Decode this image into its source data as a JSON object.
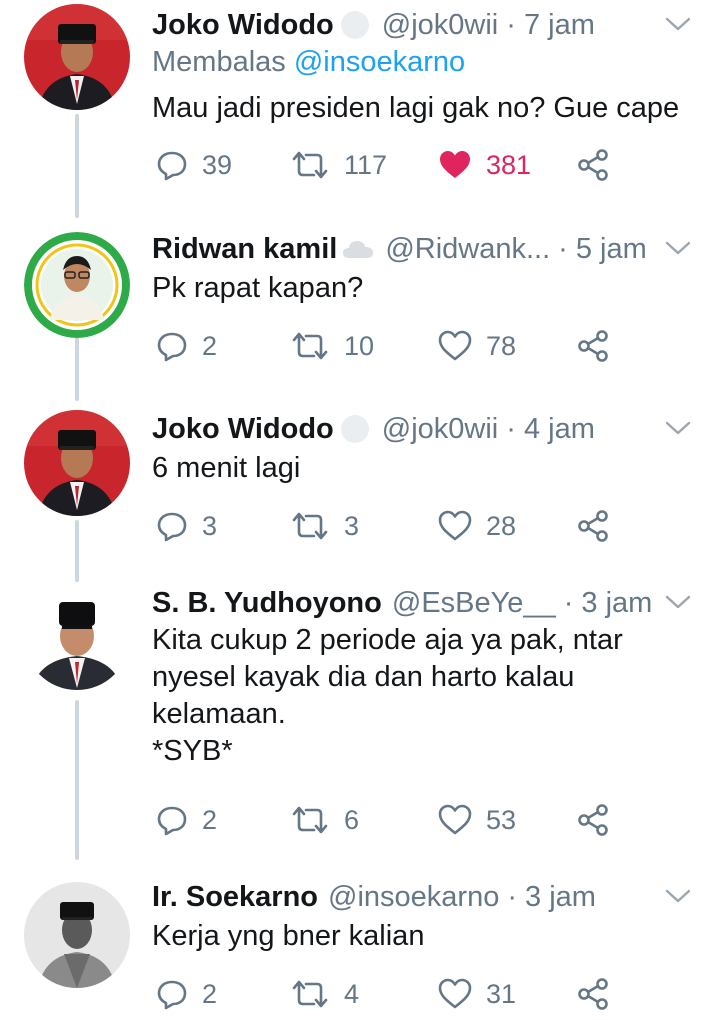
{
  "tweets": [
    {
      "name": "Joko Widodo",
      "handle": "@jok0wii",
      "time": "· 7 jam",
      "reply_prefix": "Membalas ",
      "reply_mention": "@insoekarno",
      "text": "Mau jadi presiden lagi gak no? Gue cape",
      "replies": "39",
      "retweets": "117",
      "likes": "381",
      "liked": true
    },
    {
      "name": "Ridwan kamil",
      "handle": "@Ridwank...",
      "time": "· 5 jam",
      "text": "Pk rapat kapan?",
      "replies": "2",
      "retweets": "10",
      "likes": "78",
      "liked": false
    },
    {
      "name": "Joko Widodo",
      "handle": "@jok0wii",
      "time": "· 4 jam",
      "text": "6 menit lagi",
      "replies": "3",
      "retweets": "3",
      "likes": "28",
      "liked": false
    },
    {
      "name": "S. B. Yudhoyono",
      "handle": "@EsBeYe__",
      "time": "· 3 jam",
      "text": "Kita cukup 2 periode aja ya pak, ntar\nnyesel kayak dia dan harto kalau\nkelamaan.\n*SYB*",
      "replies": "2",
      "retweets": "6",
      "likes": "53",
      "liked": false
    },
    {
      "name": "Ir. Soekarno",
      "handle": "@insoekarno",
      "time": "· 3 jam",
      "text": "Kerja yng bner kalian",
      "replies": "2",
      "retweets": "4",
      "likes": "31",
      "liked": false
    }
  ],
  "icons": {
    "reply": "reply-icon",
    "retweet": "retweet-icon",
    "like": "heart-icon",
    "share": "share-icon",
    "caret": "chevron-down-icon",
    "badge_circle": "blank-circle-badge-icon",
    "badge_cloud": "cloud-badge-icon"
  },
  "colors": {
    "text": "#14171a",
    "muted": "#657786",
    "link": "#1da1f2",
    "like": "#e0245e",
    "thread_line": "#ccd6dd"
  }
}
